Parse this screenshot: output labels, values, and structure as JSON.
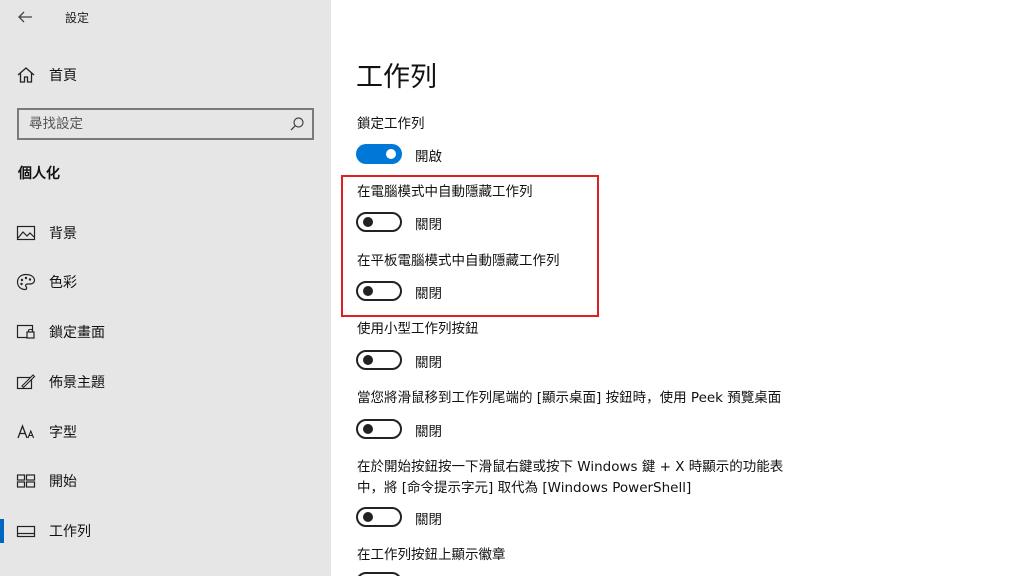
{
  "window": {
    "title": "設定"
  },
  "sidebar": {
    "home_label": "首頁",
    "search": {
      "placeholder": "尋找設定"
    },
    "group_heading": "個人化",
    "items": [
      {
        "label": "背景",
        "icon": "image-icon"
      },
      {
        "label": "色彩",
        "icon": "palette-icon"
      },
      {
        "label": "鎖定畫面",
        "icon": "lock-screen-icon"
      },
      {
        "label": "佈景主題",
        "icon": "theme-icon"
      },
      {
        "label": "字型",
        "icon": "font-icon"
      },
      {
        "label": "開始",
        "icon": "start-icon"
      },
      {
        "label": "工作列",
        "icon": "taskbar-icon",
        "active": true
      }
    ]
  },
  "main": {
    "title": "工作列",
    "settings": [
      {
        "label": "鎖定工作列",
        "state": "開啟",
        "on": true
      },
      {
        "label": "在電腦模式中自動隱藏工作列",
        "state": "關閉",
        "on": false
      },
      {
        "label": "在平板電腦模式中自動隱藏工作列",
        "state": "關閉",
        "on": false
      },
      {
        "label": "使用小型工作列按鈕",
        "state": "關閉",
        "on": false
      },
      {
        "label": "當您將滑鼠移到工作列尾端的 [顯示桌面] 按鈕時，使用 Peek 預覽桌面",
        "state": "關閉",
        "on": false
      },
      {
        "label_line1": "在於開始按鈕按一下滑鼠右鍵或按下 Windows 鍵 + X 時顯示的功能表",
        "label_line2": "中，將 [命令提示字元] 取代為 [Windows PowerShell]",
        "state": "關閉",
        "on": false
      },
      {
        "label": "在工作列按鈕上顯示徽章"
      }
    ]
  },
  "colors": {
    "accent": "#0078d7",
    "highlight": "#e02020",
    "sidebar_bg": "#e6e6e6"
  }
}
